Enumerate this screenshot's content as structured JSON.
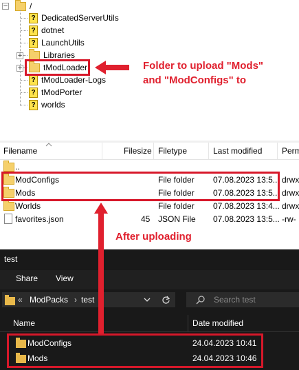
{
  "tree": {
    "root": "/",
    "items": [
      {
        "label": "DedicatedServerUtils",
        "icon": "unknown-icon"
      },
      {
        "label": "dotnet",
        "icon": "unknown-icon"
      },
      {
        "label": "LaunchUtils",
        "icon": "unknown-icon"
      },
      {
        "label": "Libraries",
        "icon": "folder-icon"
      },
      {
        "label": "tModLoader",
        "icon": "folder-icon"
      },
      {
        "label": "tModLoader-Logs",
        "icon": "unknown-icon"
      },
      {
        "label": "tModPorter",
        "icon": "unknown-icon"
      },
      {
        "label": "worlds",
        "icon": "unknown-icon"
      }
    ]
  },
  "annotations": {
    "upload_line1": "Folder to upload \"Mods\"",
    "upload_line2": "and \"ModConfigs\" to",
    "after": "After uploading",
    "color": "#e0202e"
  },
  "filelist": {
    "headers": {
      "filename": "Filename",
      "filesize": "Filesize",
      "filetype": "Filetype",
      "modified": "Last modified",
      "perm": "Perm"
    },
    "rows": [
      {
        "name": "..",
        "size": "",
        "type": "",
        "modified": "",
        "perm": "",
        "icon": "folder-icon"
      },
      {
        "name": "ModConfigs",
        "size": "",
        "type": "File folder",
        "modified": "07.08.2023 13:5...",
        "perm": "drwx",
        "icon": "folder-icon"
      },
      {
        "name": "Mods",
        "size": "",
        "type": "File folder",
        "modified": "07.08.2023 13:5...",
        "perm": "drwx",
        "icon": "folder-icon"
      },
      {
        "name": "Worlds",
        "size": "",
        "type": "File folder",
        "modified": "07.08.2023 13:4...",
        "perm": "drwx",
        "icon": "folder-icon"
      },
      {
        "name": "favorites.json",
        "size": "45",
        "type": "JSON File",
        "modified": "07.08.2023 13:5...",
        "perm": "-rw-",
        "icon": "file-icon"
      }
    ]
  },
  "explorer": {
    "title": "test",
    "ribbon": {
      "share": "Share",
      "view": "View"
    },
    "breadcrumb": {
      "prefix": "«",
      "parent": "ModPacks",
      "sep": "›",
      "current": "test"
    },
    "search_placeholder": "Search test",
    "headers": {
      "name": "Name",
      "date": "Date modified"
    },
    "rows": [
      {
        "name": "ModConfigs",
        "date": "24.04.2023 10:41"
      },
      {
        "name": "Mods",
        "date": "24.04.2023 10:46"
      }
    ]
  }
}
